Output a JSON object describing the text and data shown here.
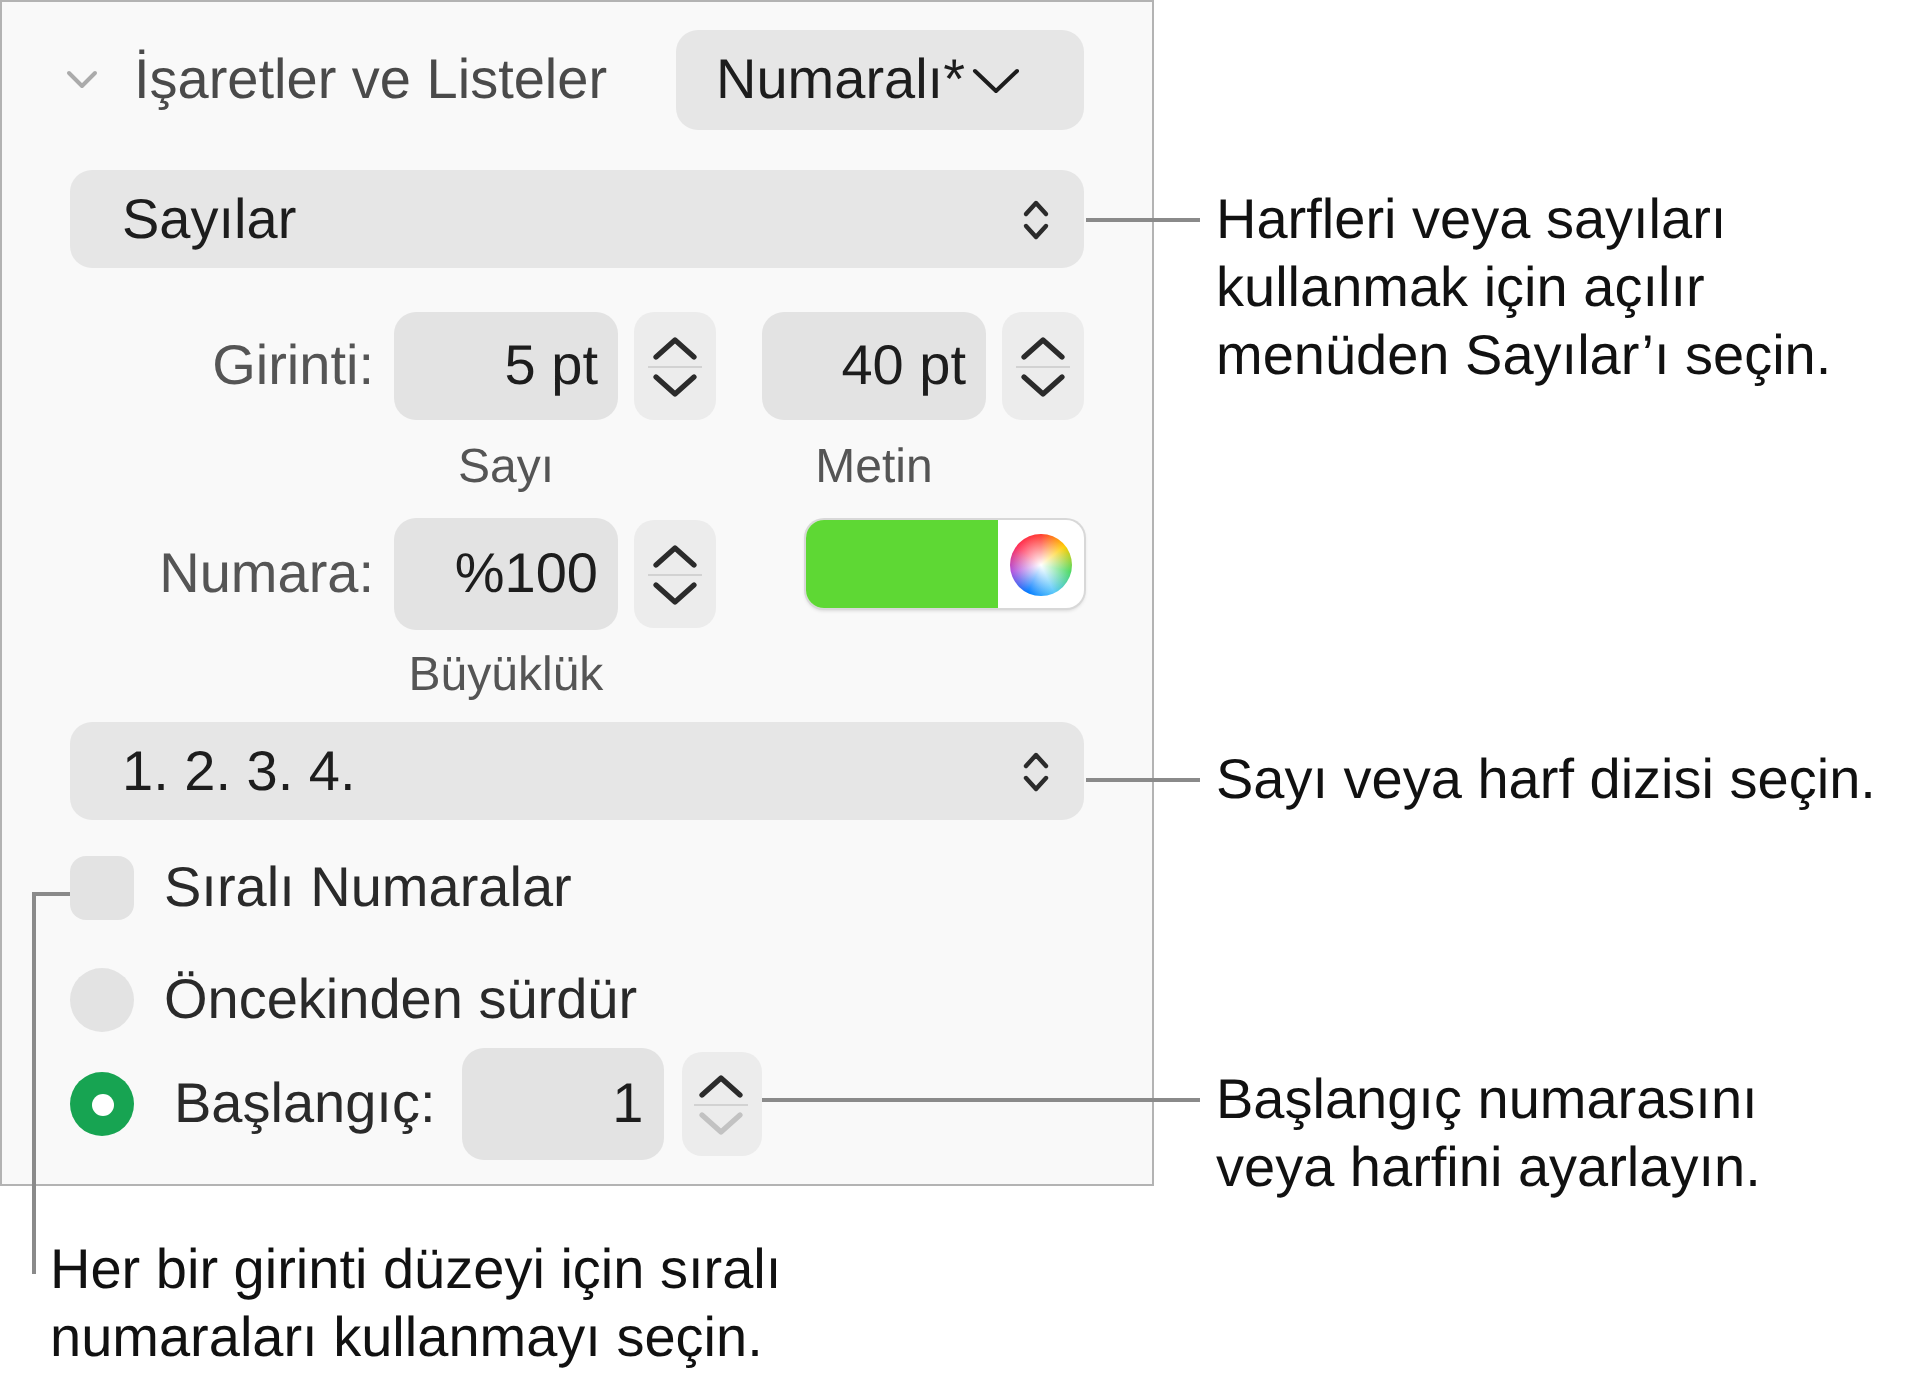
{
  "panel": {
    "section": {
      "title": "İşaretler ve Listeler",
      "expanded": true
    },
    "style_popup": {
      "value": "Numaralı*"
    },
    "type_popup": {
      "value": "Sayılar"
    },
    "indent": {
      "label": "Girinti:",
      "fields": [
        {
          "value": "5 pt",
          "caption": "Sayı",
          "decrement_disabled": false
        },
        {
          "value": "40 pt",
          "caption": "Metin",
          "decrement_disabled": false
        }
      ]
    },
    "number": {
      "label": "Numara:",
      "size": {
        "value": "%100",
        "caption": "Büyüklük",
        "decrement_disabled": false
      },
      "color_well": {
        "color": "#5ed834"
      }
    },
    "sequence_popup": {
      "value": "1. 2. 3. 4."
    },
    "options": [
      {
        "kind": "checkbox",
        "label": "Sıralı Numaralar",
        "checked": false
      },
      {
        "kind": "radio",
        "label": "Öncekinden sürdür",
        "selected": false
      },
      {
        "kind": "radio_field",
        "label": "Başlangıç:",
        "selected": true,
        "value": "1",
        "decrement_disabled": true
      }
    ]
  },
  "callouts": [
    {
      "text": "Harfleri veya sayıları kullanmak için açılır menüden Sayılar’ı seçin."
    },
    {
      "text": "Sayı veya harf dizisi seçin."
    },
    {
      "text": "Başlangıç numarasını veya harfini ayarlayın."
    },
    {
      "text": "Her bir girinti düzeyi için sıralı numaraları kullanmayı seçin."
    }
  ]
}
